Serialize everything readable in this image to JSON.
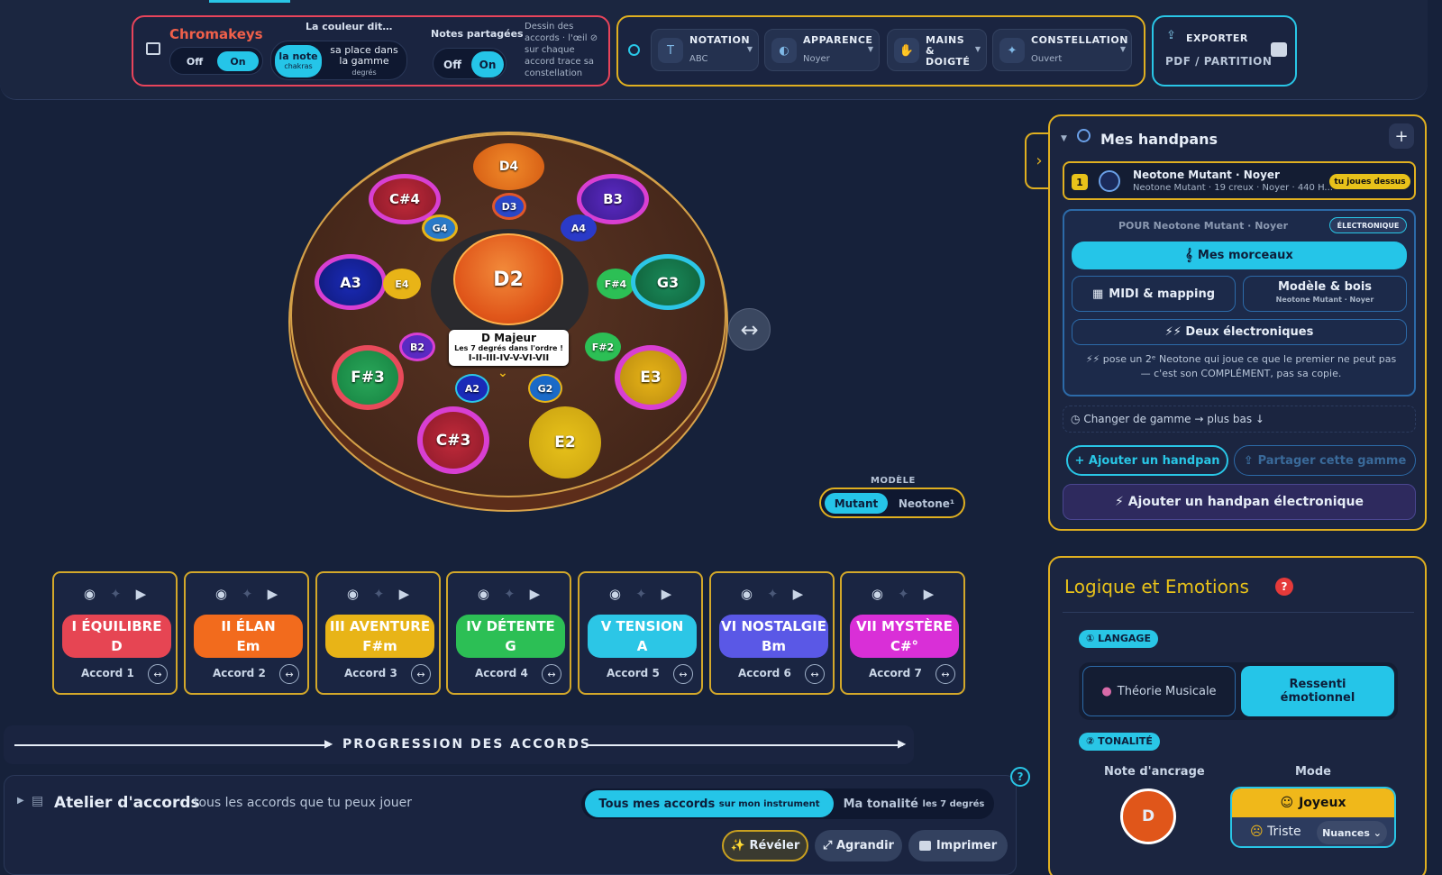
{
  "toolbar": {
    "chromakeys": {
      "title": "Chromakeys",
      "off": "Off",
      "on": "On"
    },
    "couleur": {
      "title": "La couleur dit…",
      "opt1_main": "la note",
      "opt1_sub": "chakras",
      "opt2_main": "sa place dans la gamme",
      "opt2_sub": "degrés"
    },
    "notes_partagees": {
      "title": "Notes partagées",
      "off": "Off",
      "on": "On",
      "desc": "Dessin des accords · l'œil ⊘ sur chaque accord trace sa constellation"
    },
    "notation": {
      "title": "NOTATION",
      "value": "ABC"
    },
    "apparence": {
      "title": "APPARENCE",
      "value": "Noyer"
    },
    "mains": {
      "title": "MAINS & DOIGTÉ"
    },
    "constellation": {
      "title": "CONSTELLATION",
      "value": "Ouvert"
    },
    "exporter": {
      "title": "EXPORTER",
      "value": "PDF / PARTITION"
    }
  },
  "handpan": {
    "notes": [
      {
        "label": "D4"
      },
      {
        "label": "D3"
      },
      {
        "label": "C#4"
      },
      {
        "label": "B3"
      },
      {
        "label": "G4"
      },
      {
        "label": "A4"
      },
      {
        "label": "A3"
      },
      {
        "label": "E4"
      },
      {
        "label": "D2"
      },
      {
        "label": "F#4"
      },
      {
        "label": "G3"
      },
      {
        "label": "B2"
      },
      {
        "label": "F#2"
      },
      {
        "label": "F#3"
      },
      {
        "label": "E3"
      },
      {
        "label": "A2"
      },
      {
        "label": "G2"
      },
      {
        "label": "C#3"
      },
      {
        "label": "E2"
      }
    ],
    "tooltip": {
      "title": "D Majeur",
      "line2": "Les 7 degrés dans l'ordre !",
      "line3": "I-II-III-IV-V-VI-VII"
    },
    "modele": {
      "label": "MODÈLE",
      "opt1": "Mutant",
      "opt2": "Neotone¹"
    }
  },
  "chords": [
    {
      "degree": "I ÉQUILIBRE",
      "chord": "D",
      "label": "Accord 1",
      "color": "#e64553"
    },
    {
      "degree": "II ÉLAN",
      "chord": "Em",
      "label": "Accord 2",
      "color": "#f26b1d"
    },
    {
      "degree": "III AVENTURE",
      "chord": "F#m",
      "label": "Accord 3",
      "color": "#e8b417"
    },
    {
      "degree": "IV DÉTENTE",
      "chord": "G",
      "label": "Accord 4",
      "color": "#2cbf55"
    },
    {
      "degree": "V TENSION",
      "chord": "A",
      "label": "Accord 5",
      "color": "#2cc6e6"
    },
    {
      "degree": "VI NOSTALGIE",
      "chord": "Bm",
      "label": "Accord 6",
      "color": "#5a58e6"
    },
    {
      "degree": "VII MYSTÈRE",
      "chord": "C#°",
      "label": "Accord 7",
      "color": "#d92fd7"
    }
  ],
  "progression": {
    "title": "PROGRESSION DES ACCORDS"
  },
  "atelier": {
    "title": "Atelier d'accords",
    "subtitle": "tous les accords que tu peux jouer",
    "tab1": "Tous mes accords",
    "tab1_sub": "sur mon instrument",
    "tab2": "Ma tonalité",
    "tab2_sub": "les 7 degrés",
    "reveal": "✨ Révéler",
    "enlarge": "⤢ Agrandir",
    "print": "Imprimer"
  },
  "handpans_panel": {
    "title": "Mes handpans",
    "item": {
      "index": "1",
      "name": "Neotone Mutant · Noyer",
      "details": "Neotone Mutant · 19 creux · Noyer · 440 H...",
      "badge": "tu joues dessus"
    },
    "pour": "POUR Neotone Mutant · Noyer",
    "type_badge": "ÉLECTRONIQUE",
    "mes_morceaux": "Mes morceaux",
    "midi": "MIDI & mapping",
    "modele_bois": "Modèle & bois",
    "modele_bois_sub": "Neotone Mutant · Noyer",
    "deux_electro": "⚡⚡ Deux électroniques",
    "note": "⚡⚡ pose un 2ᵉ Neotone qui joue ce que le premier ne peut pas — c'est son COMPLÉMENT, pas sa copie.",
    "changer": "Changer de gamme → plus bas ↓",
    "ajouter": "+ Ajouter un handpan",
    "partager": "Partager cette gamme",
    "ajouter_electro": "⚡ Ajouter un handpan électronique"
  },
  "emotions_panel": {
    "title": "Logique et Emotions",
    "langage": "① LANGAGE",
    "theorie": "Théorie Musicale",
    "ressenti": "Ressenti émotionnel",
    "tonalite": "② TONALITÉ",
    "note_ancrage": "Note d'ancrage",
    "ancrage_value": "D",
    "mode": "Mode",
    "joyeux": "Joyeux",
    "triste": "Triste",
    "nuances": "Nuances ⌄"
  }
}
